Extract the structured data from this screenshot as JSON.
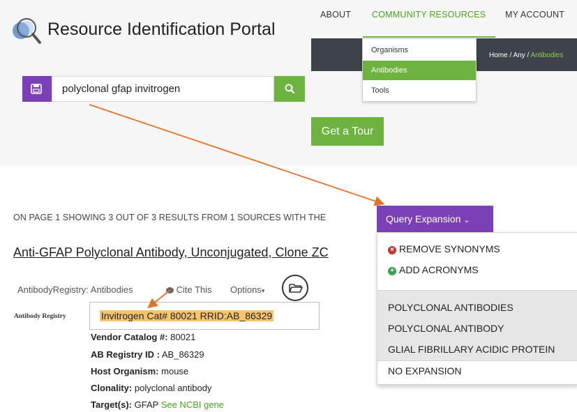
{
  "header": {
    "title": "Resource Identification Portal",
    "nav": {
      "about": "ABOUT",
      "community": "COMMUNITY RESOURCES",
      "account": "MY ACCOUNT"
    },
    "community_menu": [
      "Organisms",
      "Antibodies",
      "Tools"
    ],
    "breadcrumb": {
      "home": "Home",
      "sep": "/",
      "any": "Any",
      "current": "Antibodies"
    }
  },
  "search": {
    "value": "polyclonal gfap invitrogen"
  },
  "tour": {
    "label": "Get a Tour"
  },
  "results": {
    "summary": "ON PAGE 1 SHOWING 3 OUT OF 3 RESULTS FROM 1 SOURCES WITH THE",
    "query_expansion": {
      "label": "Query Expansion",
      "remove": "REMOVE SYNONYMS",
      "add": "ADD ACRONYMS",
      "terms": [
        "POLYCLONAL ANTIBODIES",
        "POLYCLONAL ANTIBODY",
        "GLIAL FIBRILLARY ACIDIC PROTEIN"
      ],
      "no_expansion": "NO EXPANSION"
    },
    "item": {
      "title": "Anti-GFAP Polyclonal Antibody, Unconjugated, Clone ZC",
      "source": "AntibodyRegistry: Antibodies",
      "cite": "Cite This",
      "options": "Options",
      "registry_label": "Antibody Registry",
      "citation": "Invitrogen Cat# 80021 RRID:AB_86329",
      "vendor_catalog_label": "Vendor Catalog #:",
      "vendor_catalog": "80021",
      "ab_registry_label": "AB Registry ID :",
      "ab_registry": "AB_86329",
      "host_label": "Host Organism:",
      "host": "mouse",
      "clonality_label": "Clonality:",
      "clonality": "polyclonal antibody",
      "targets_label": "Target(s):",
      "targets": "GFAP",
      "ncbi_link": "See NCBI gene"
    }
  },
  "colors": {
    "purple": "#7b3fb6",
    "green": "#6cb33f",
    "highlight": "#f7c46c",
    "arrow": "#e0732a"
  }
}
